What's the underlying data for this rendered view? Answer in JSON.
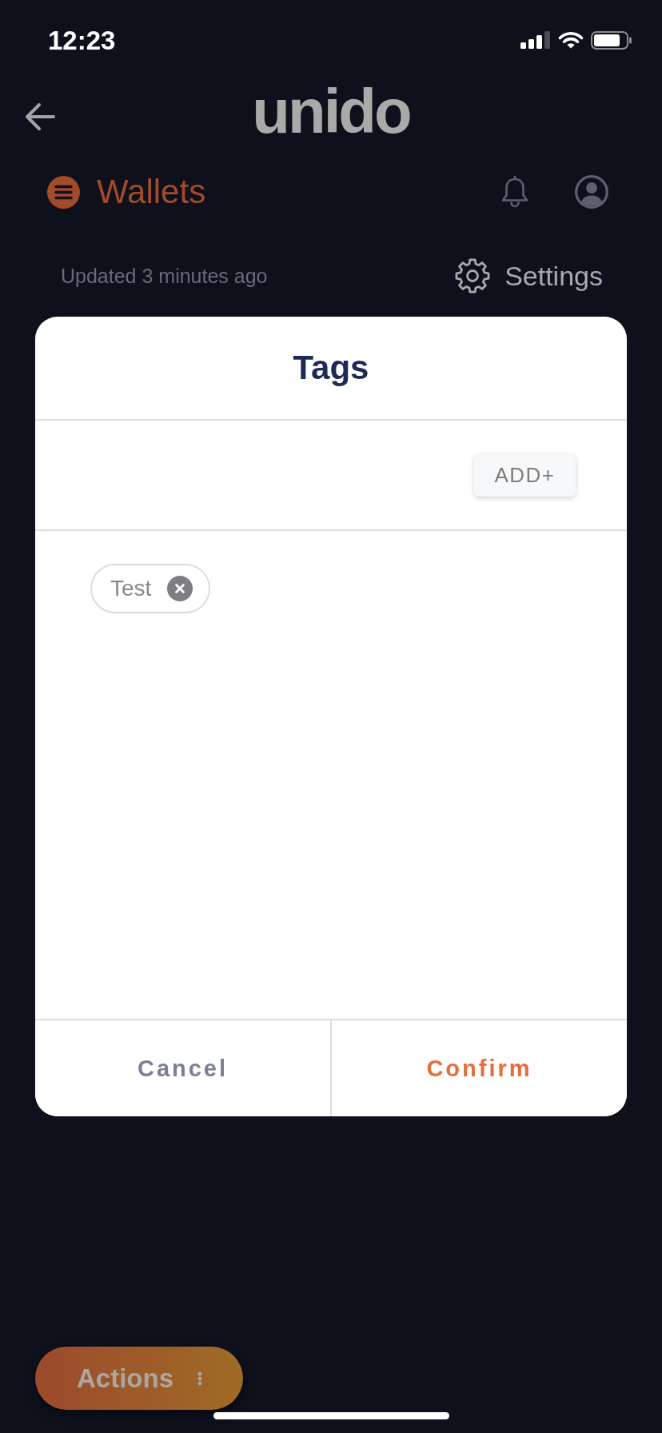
{
  "status_bar": {
    "time": "12:23"
  },
  "header": {
    "logo": "unido"
  },
  "wallet_bar": {
    "title": "Wallets"
  },
  "update_row": {
    "updated": "Updated 3 minutes ago",
    "settings": "Settings"
  },
  "dialog": {
    "title": "Tags",
    "add_button": "ADD+",
    "tags": [
      {
        "label": "Test"
      }
    ],
    "buttons": [
      {
        "label": "Cancel",
        "kind": "secondary"
      },
      {
        "label": "Confirm",
        "kind": "primary"
      }
    ]
  },
  "actions_button": {
    "label": "Actions"
  }
}
